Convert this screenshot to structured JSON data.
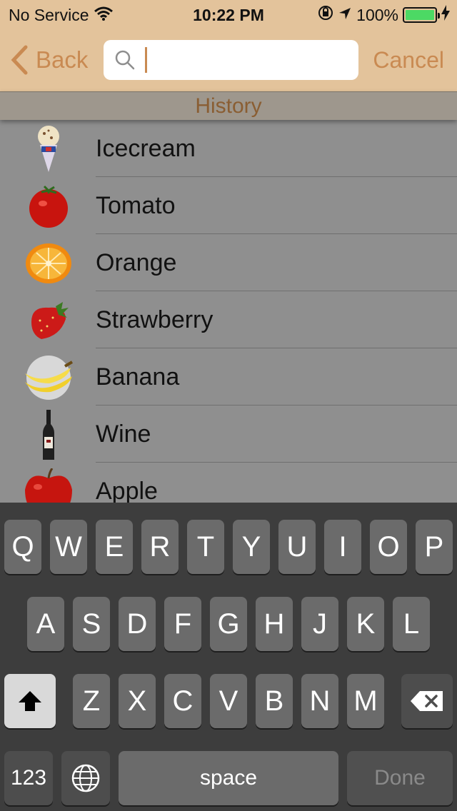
{
  "status_bar": {
    "carrier": "No Service",
    "time": "10:22 PM",
    "battery": "100%"
  },
  "nav": {
    "back_label": "Back",
    "search_value": "",
    "cancel_label": "Cancel"
  },
  "section": {
    "title": "History"
  },
  "items": [
    {
      "label": "Icecream",
      "icon": "icecream-icon"
    },
    {
      "label": "Tomato",
      "icon": "tomato-icon"
    },
    {
      "label": "Orange",
      "icon": "orange-icon"
    },
    {
      "label": "Strawberry",
      "icon": "strawberry-icon"
    },
    {
      "label": "Banana",
      "icon": "banana-icon"
    },
    {
      "label": "Wine",
      "icon": "wine-icon"
    },
    {
      "label": "Apple",
      "icon": "apple-icon"
    }
  ],
  "keyboard": {
    "row1": [
      "Q",
      "W",
      "E",
      "R",
      "T",
      "Y",
      "U",
      "I",
      "O",
      "P"
    ],
    "row2": [
      "A",
      "S",
      "D",
      "F",
      "G",
      "H",
      "J",
      "K",
      "L"
    ],
    "row3": [
      "Z",
      "X",
      "C",
      "V",
      "B",
      "N",
      "M"
    ],
    "numbers_label": "123",
    "space_label": "space",
    "done_label": "Done"
  },
  "colors": {
    "nav_background": "#e3c39b",
    "accent": "#c98a52",
    "battery_fill": "#4cd964"
  }
}
